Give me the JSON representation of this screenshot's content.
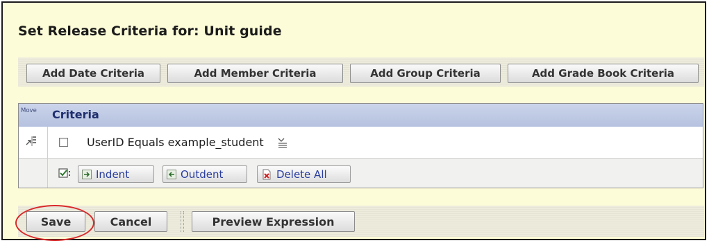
{
  "page": {
    "title": "Set Release Criteria for: Unit guide"
  },
  "toolbar": {
    "buttons": [
      {
        "label": "Add Date Criteria"
      },
      {
        "label": "Add Member Criteria"
      },
      {
        "label": "Add Group Criteria"
      },
      {
        "label": "Add Grade Book Criteria"
      }
    ]
  },
  "criteria_table": {
    "move_header": "Move",
    "criteria_header": "Criteria",
    "rows": [
      {
        "text": "UserID Equals example_student",
        "checked": false
      }
    ],
    "actions": [
      {
        "label": "Indent",
        "icon": "indent-icon"
      },
      {
        "label": "Outdent",
        "icon": "outdent-icon"
      },
      {
        "label": "Delete All",
        "icon": "delete-icon"
      }
    ]
  },
  "footer": {
    "buttons": [
      {
        "label": "Save"
      },
      {
        "label": "Cancel"
      },
      {
        "label": "Preview Expression"
      }
    ]
  },
  "colors": {
    "background": "#fdfcd8",
    "header_blue": "#b5c1df",
    "link_blue": "#2a3da0",
    "highlight_red": "#d8292a"
  }
}
